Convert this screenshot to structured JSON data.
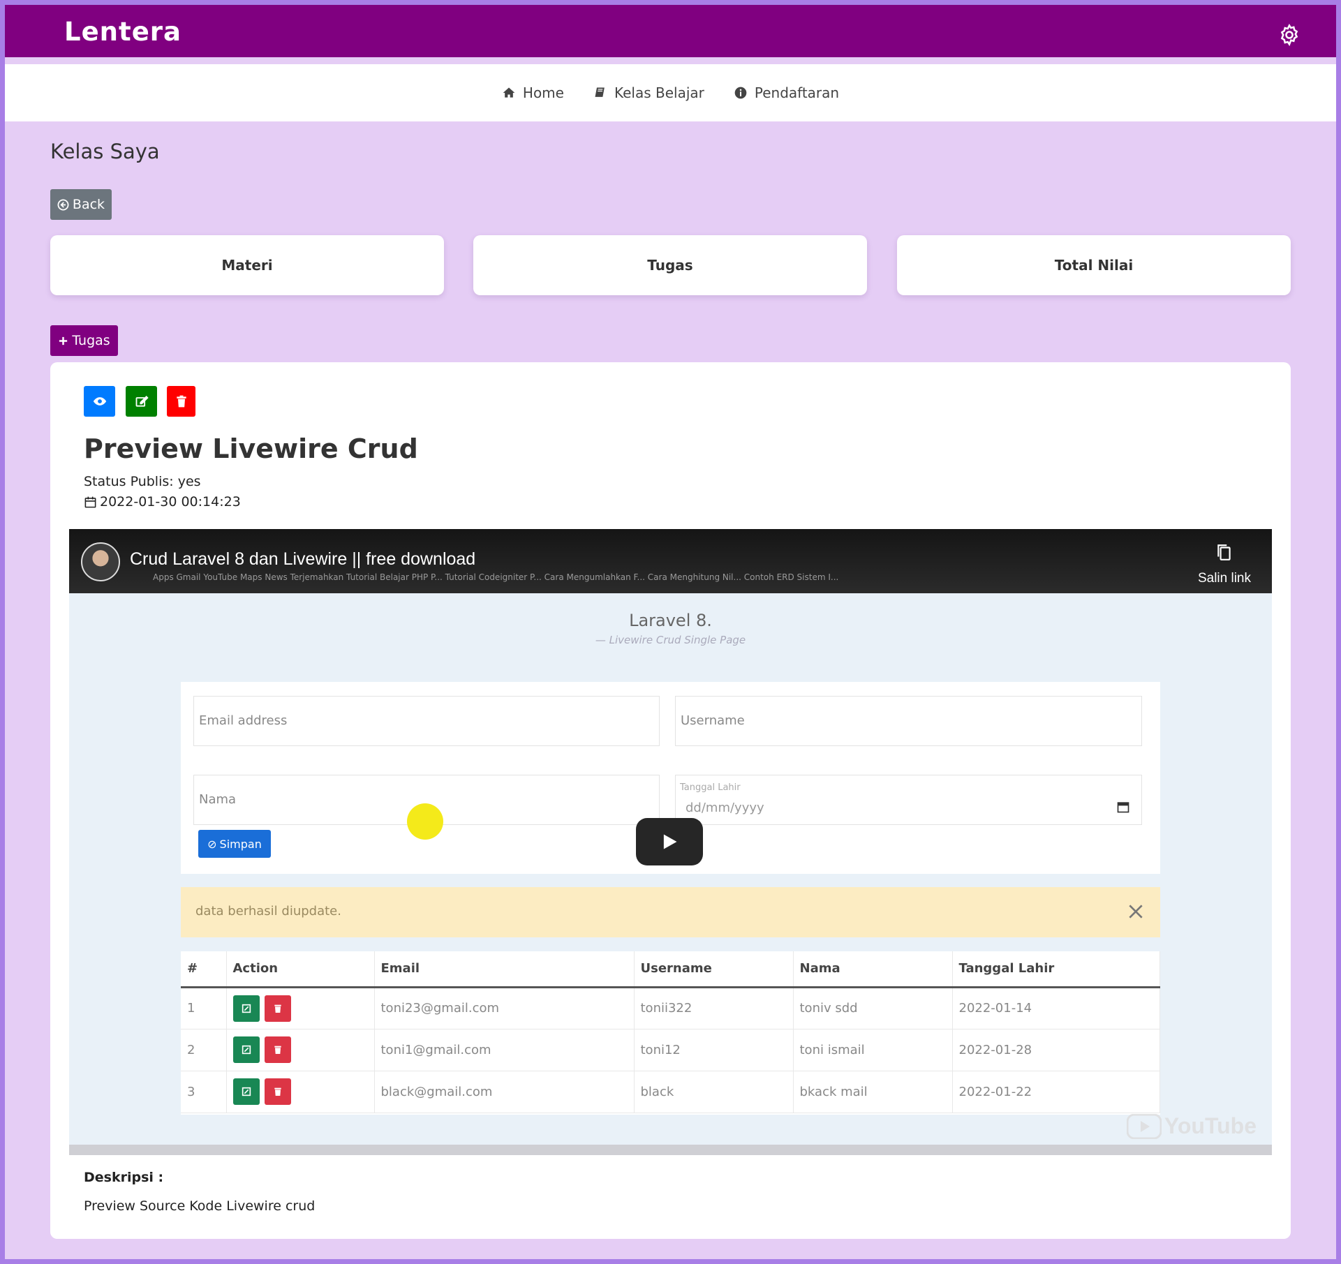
{
  "header": {
    "brand": "Lentera"
  },
  "nav": [
    {
      "label": "Home",
      "icon": "home-icon"
    },
    {
      "label": "Kelas Belajar",
      "icon": "book-icon"
    },
    {
      "label": "Pendaftaran",
      "icon": "info-icon"
    }
  ],
  "page": {
    "title": "Kelas Saya",
    "back_label": "Back",
    "add_label": "Tugas"
  },
  "tabs": [
    "Materi",
    "Tugas",
    "Total Nilai"
  ],
  "post": {
    "title": "Preview Livewire Crud",
    "status": "Status Publis: yes",
    "date": "2022-01-30 00:14:23",
    "desc_label": "Deskripsi :",
    "desc_text": "Preview Source Kode Livewire crud"
  },
  "video": {
    "title": "Crud Laravel 8 dan Livewire || free download",
    "copy_link": "Salin link",
    "app_title": "Laravel 8.",
    "app_subtitle": "— Livewire Crud Single Page",
    "email_placeholder": "Email address",
    "username_placeholder": "Username",
    "nama_placeholder": "Nama",
    "date_label": "Tanggal Lahir",
    "date_value": "dd/mm/yyyy",
    "save_label": "Simpan",
    "alert": "data berhasil diupdate.",
    "watermark": "YouTube",
    "bookmarks": "Apps   Gmail   YouTube   Maps   News   Terjemahkan   Tutorial Belajar PHP P...   Tutorial Codeigniter P...   Cara Mengumlahkan F...   Cara Menghitung Nil...   Contoh ERD Sistem I...",
    "table": {
      "headers": [
        "#",
        "Action",
        "Email",
        "Username",
        "Nama",
        "Tanggal Lahir"
      ],
      "rows": [
        [
          "1",
          "toni23@gmail.com",
          "tonii322",
          "toniv sdd",
          "2022-01-14"
        ],
        [
          "2",
          "toni1@gmail.com",
          "toni12",
          "toni ismail",
          "2022-01-28"
        ],
        [
          "3",
          "black@gmail.com",
          "black",
          "bkack mail",
          "2022-01-22"
        ]
      ]
    }
  },
  "colors": {
    "brand": "#800080",
    "background": "#e5cdf5",
    "view_button": "#007bff",
    "edit_button": "#008000",
    "delete_button": "#ff0000"
  }
}
